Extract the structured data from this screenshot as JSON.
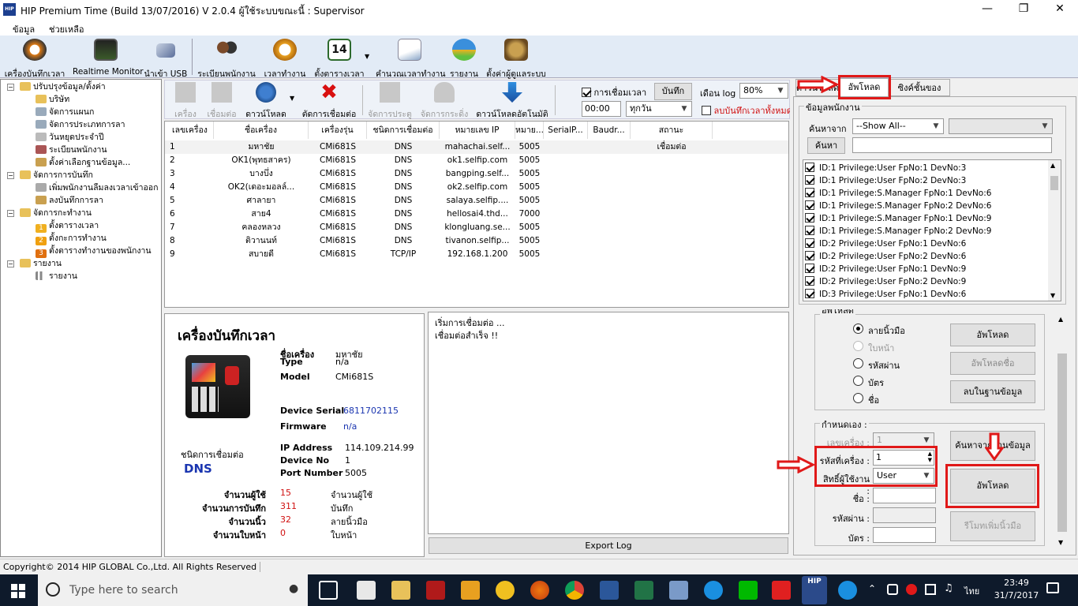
{
  "window": {
    "title": "HIP Premium Time (Build 13/07/2016) V 2.0.4   ผู้ใช้ระบบขณะนี้ : Supervisor",
    "app_icon_text": "HIP"
  },
  "menu": [
    "ข้อมูล",
    "ช่วยเหลือ"
  ],
  "toolbar": [
    "เครื่องบันทึกเวลา",
    "Realtime Monitor",
    "นำเข้า USB",
    "ระเบียนพนักงาน",
    "เวลาทำงาน",
    "ตั้งตารางเวลา",
    "คำนวณเวลาทำงาน",
    "รายงาน",
    "ตั้งค่าผู้ดูแลระบบ"
  ],
  "calendar_day": "14",
  "tree": {
    "g1": "ปรับปรุงข้อมูล/ตั้งค่า",
    "g1_items": [
      "บริษัท",
      "จัดการแผนก",
      "จัดการประเภทการลา",
      "วันหยุดประจำปี",
      "ระเบียนพนักงาน",
      "ตั้งค่าเลือกฐานข้อมูล..."
    ],
    "g2": "จัดการการบันทึก",
    "g2_items": [
      "เพิ่มพนักงานลืมลงเวลาเข้าออก",
      "ลงบันทึกการลา"
    ],
    "g3": "จัดการกะทำงาน",
    "g3_items": [
      "ตั้งตารางเวลา",
      "ตั้งกะการทำงาน",
      "ตั้งตารางทำงานของพนักงาน"
    ],
    "g3_nums": [
      "1",
      "2",
      "3"
    ],
    "g4": "รายงาน",
    "g4_items": [
      "รายงาน"
    ]
  },
  "devtool": {
    "buttons": [
      "เครื่อง",
      "เชื่อมต่อ",
      "ดาวน์โหลด",
      "ตัดการเชื่อมต่อ",
      "จัดการประตู",
      "จัดการกระดิ่ง",
      "ดาวน์โหลดอัตโนมัติ"
    ],
    "conn_time_label": "การเชื่อมเวลา",
    "save_btn": "บันทึก",
    "month_log": "เดือน log",
    "pct": "80%",
    "time": "00:00",
    "every": "ทุกวัน",
    "delete_all": "ลบบันทึกเวลาทั้งหมด"
  },
  "devlist": {
    "headers": [
      "เลขเครื่อง",
      "ชื่อเครื่อง",
      "เครื่องรุ่น",
      "ชนิดการเชื่อมต่อ",
      "หมายเลข IP",
      "หมาย...",
      "SerialP...",
      "Baudr...",
      "สถานะ"
    ],
    "rows": [
      [
        "1",
        "มหาชัย",
        "CMi681S",
        "DNS",
        "mahachai.self...",
        "5005",
        "",
        "",
        "เชื่อมต่อ"
      ],
      [
        "2",
        "OK1(พุทธสาคร)",
        "CMi681S",
        "DNS",
        "ok1.selfip.com",
        "5005",
        "",
        "",
        ""
      ],
      [
        "3",
        "บางบึ่ง",
        "CMi681S",
        "DNS",
        "bangping.self...",
        "5005",
        "",
        "",
        ""
      ],
      [
        "4",
        "OK2(เดอะมอลล์...",
        "CMi681S",
        "DNS",
        "ok2.selfip.com",
        "5005",
        "",
        "",
        ""
      ],
      [
        "5",
        "ศาลายา",
        "CMi681S",
        "DNS",
        "salaya.selfip....",
        "5005",
        "",
        "",
        ""
      ],
      [
        "6",
        "สาย4",
        "CMi681S",
        "DNS",
        "hellosai4.thd...",
        "7000",
        "",
        "",
        ""
      ],
      [
        "7",
        "คลองหลวง",
        "CMi681S",
        "DNS",
        "klongluang.se...",
        "5005",
        "",
        "",
        ""
      ],
      [
        "8",
        "ติวานนท์",
        "CMi681S",
        "DNS",
        "tivanon.selfip...",
        "5005",
        "",
        "",
        ""
      ],
      [
        "9",
        "สบายดี",
        "CMi681S",
        "TCP/IP",
        "192.168.1.200",
        "5005",
        "",
        "",
        ""
      ]
    ]
  },
  "info": {
    "title": "เครื่องบันทึกเวลา",
    "name_l": "ชื่อเครื่อง",
    "name_v": "มหาชัย",
    "type_l": "Type",
    "type_v": "n/a",
    "model_l": "Model",
    "model_v": "CMi681S",
    "serial_l": "Device Serial",
    "serial_v": "6811702115",
    "fw_l": "Firmware",
    "fw_v": "n/a",
    "conn_l": "ชนิดการเชื่อมต่อ",
    "conn_v": "DNS",
    "ip_l": "IP Address",
    "ip_v": "114.109.214.99",
    "dno_l": "Device No",
    "dno_v": "1",
    "port_l": "Port Number",
    "port_v": "5005",
    "stats": [
      [
        "จำนวนผู้ใช้",
        "15",
        "จำนวนผู้ใช้"
      ],
      [
        "จำนวนการบันทึก",
        "311",
        "บันทึก"
      ],
      [
        "จำนวนนิ้ว",
        "32",
        "ลายนิ้วมือ"
      ],
      [
        "จำนวนใบหน้า",
        "0",
        "ใบหน้า"
      ]
    ]
  },
  "log": {
    "lines": [
      "เริ่มการเชื่อมต่อ ...",
      "เชื่อมต่อสำเร็จ !!"
    ],
    "export": "Export Log"
  },
  "rpanel": {
    "tab1": "ดาวน์โหลด",
    "tab2": "อัพโหลด",
    "tab3": "ซิงค์ชั้นของระบบ",
    "grp_emp": "ข้อมูลพนักงาน",
    "search_from": "ค้นหาจาก",
    "show_all": "--Show All--",
    "search_btn": "ค้นหา",
    "list": [
      "ID:1 Privilege:User FpNo:1 DevNo:3",
      "ID:1 Privilege:User FpNo:2 DevNo:3",
      "ID:1 Privilege:S.Manager FpNo:1 DevNo:6",
      "ID:1 Privilege:S.Manager FpNo:2 DevNo:6",
      "ID:1 Privilege:S.Manager FpNo:1 DevNo:9",
      "ID:1 Privilege:S.Manager FpNo:2 DevNo:9",
      "ID:2 Privilege:User FpNo:1 DevNo:6",
      "ID:2 Privilege:User FpNo:2 DevNo:6",
      "ID:2 Privilege:User FpNo:1 DevNo:9",
      "ID:2 Privilege:User FpNo:2 DevNo:9",
      "ID:3 Privilege:User FpNo:1 DevNo:6"
    ],
    "grp_up": "อัพโหลด",
    "radios": [
      "ลายนิ้วมือ",
      "ใบหน้า",
      "รหัสผ่าน",
      "บัตร",
      "ชื่อ"
    ],
    "btn_upload": "อัพโหลด",
    "btn_upload_name": "อัพโหลดชื่อ",
    "btn_delete_db": "ลบในฐานข้อมูล",
    "grp_custom": "กำหนดเอง :",
    "dev_no_l": "เลขเครื่อง :",
    "dev_no_v": "1",
    "code_l": "รหัสที่เครื่อง :",
    "code_v": "1",
    "priv_l": "สิทธิ์ผู้ใช้งาน :",
    "priv_v": "User",
    "name_l": "ชื่อ :",
    "pw_l": "รหัสผ่าน :",
    "card_l": "บัตร :",
    "btn_search_db": "ค้นหาจากฐานข้อมูล",
    "btn_upload2": "อัพโหลด",
    "btn_remote": "รีโมทเพิ่มนิ้วมือ"
  },
  "status": "Copyright© 2014 HIP GLOBAL Co.,Ltd. All Rights Reserved",
  "taskbar": {
    "search": "Type here to search",
    "lang": "ไทย",
    "time": "23:49",
    "date": "31/7/2017",
    "hip_text": "HIP"
  },
  "colors": {
    "accent_red": "#e01919",
    "link_blue": "#1a35b0",
    "stat_red": "#d01010"
  }
}
